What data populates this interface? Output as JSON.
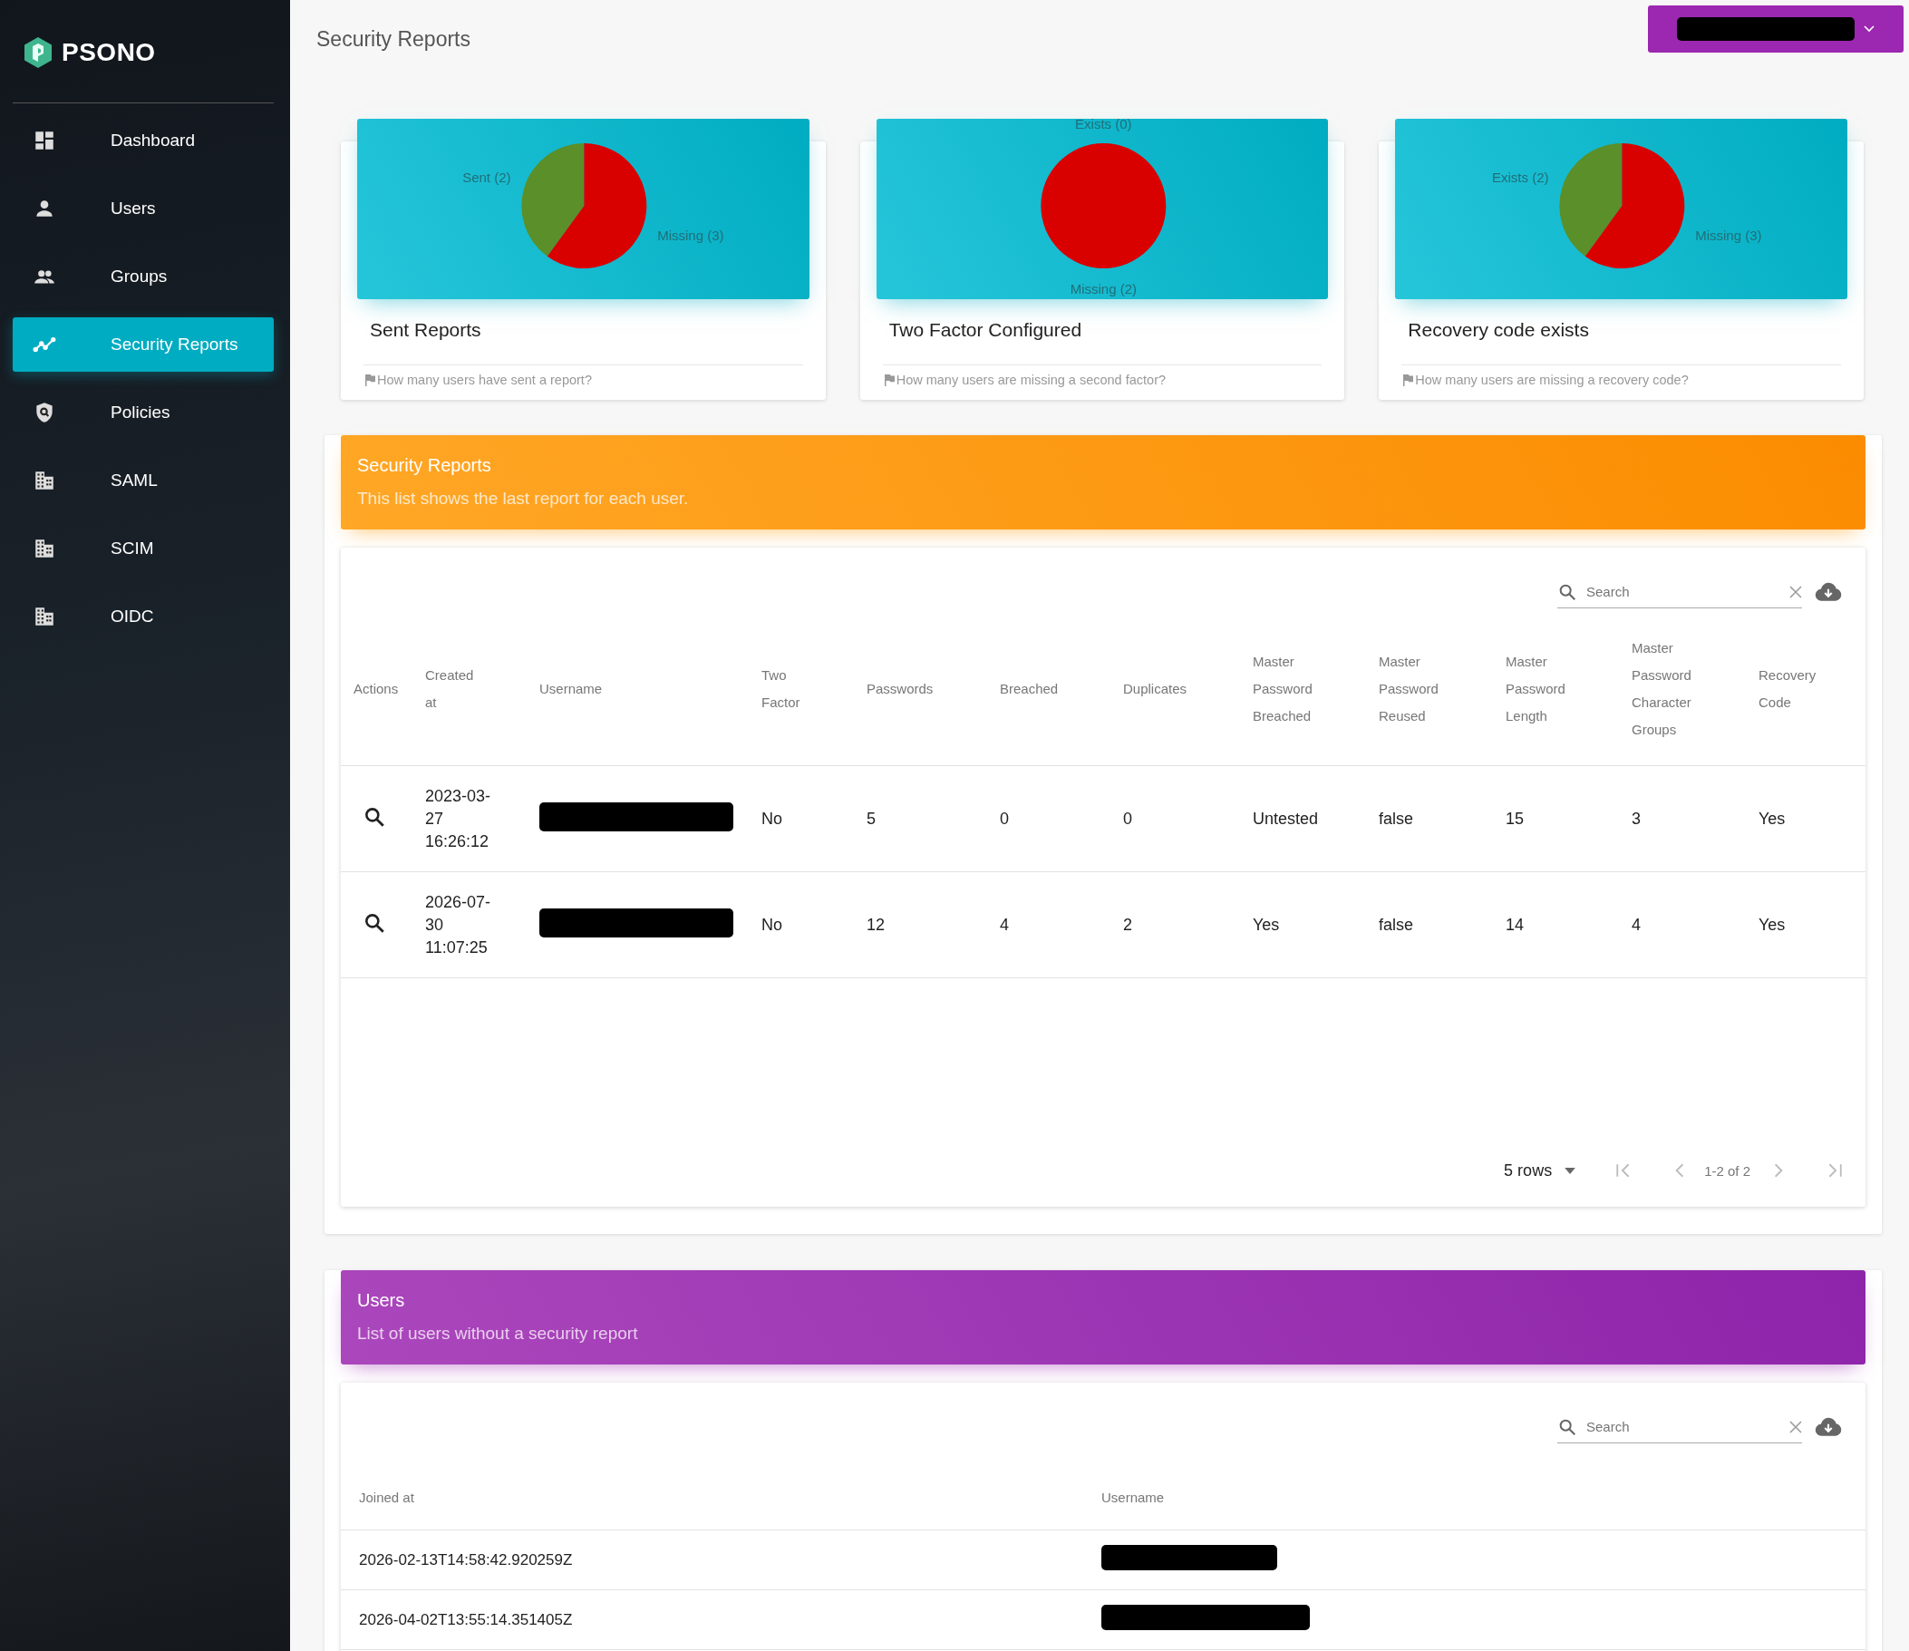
{
  "sidebar": {
    "brand": "PSONO",
    "items": [
      {
        "label": "Dashboard",
        "kind": "dashboard",
        "selected": false
      },
      {
        "label": "Users",
        "kind": "user",
        "selected": false
      },
      {
        "label": "Groups",
        "kind": "group",
        "selected": false
      },
      {
        "label": "Security Reports",
        "kind": "trend",
        "selected": true
      },
      {
        "label": "Policies",
        "kind": "policy",
        "selected": false
      },
      {
        "label": "SAML",
        "kind": "building",
        "selected": false
      },
      {
        "label": "SCIM",
        "kind": "building",
        "selected": false
      },
      {
        "label": "OIDC",
        "kind": "building",
        "selected": false
      }
    ]
  },
  "header": {
    "title": "Security Reports"
  },
  "cards": [
    {
      "title": "Sent Reports",
      "note": "How many users have sent a report?",
      "chart_data": {
        "type": "pie",
        "categories": [
          "Sent (2)",
          "Missing (3)"
        ],
        "values": [
          2,
          3
        ]
      }
    },
    {
      "title": "Two Factor Configured",
      "note": "How many users are missing a second factor?",
      "chart_data": {
        "type": "pie",
        "categories": [
          "Exists (0)",
          "Missing (2)"
        ],
        "values": [
          0,
          2
        ]
      }
    },
    {
      "title": "Recovery code exists",
      "note": "How many users are missing a recovery code?",
      "chart_data": {
        "type": "pie",
        "categories": [
          "Exists (2)",
          "Missing (3)"
        ],
        "values": [
          2,
          3
        ]
      }
    }
  ],
  "reports": {
    "title": "Security Reports",
    "subtitle": "This list shows the last report for each user.",
    "search": {
      "placeholder": "Search"
    },
    "columns": [
      "Actions",
      "Created at",
      "Username",
      "Two Factor",
      "Passwords",
      "Breached",
      "Duplicates",
      "Master Password Breached",
      "Master Password Reused",
      "Master Password Length",
      "Master Password Character Groups",
      "Recovery Code"
    ],
    "rows": [
      {
        "created_at": "2023-03-27 16:26:12",
        "values": [
          "No",
          "5",
          "0",
          "0",
          "Untested",
          "false",
          "15",
          "3",
          "Yes"
        ]
      },
      {
        "created_at": "2026-07-30 11:07:25",
        "values": [
          "No",
          "12",
          "4",
          "2",
          "Yes",
          "false",
          "14",
          "4",
          "Yes"
        ]
      }
    ],
    "pagination": {
      "rows_per_page": "5 rows",
      "range": "1-2 of 2"
    }
  },
  "users": {
    "title": "Users",
    "subtitle": "List of users without a security report",
    "search": {
      "placeholder": "Search"
    },
    "columns": [
      "Joined at",
      "Username"
    ],
    "rows": [
      {
        "joined_at": "2026-02-13T14:58:42.920259Z"
      },
      {
        "joined_at": "2026-04-02T13:55:14.351405Z"
      }
    ]
  }
}
